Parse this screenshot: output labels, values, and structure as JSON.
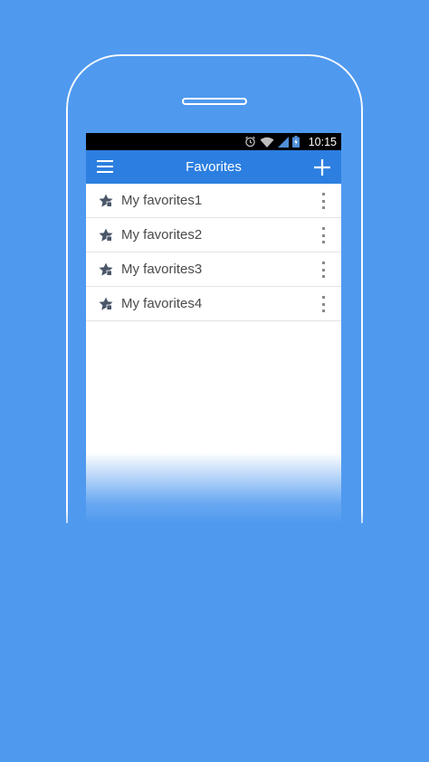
{
  "status_bar": {
    "time": "10:15",
    "icons": [
      "alarm-icon",
      "wifi-icon",
      "signal-icon",
      "battery-charging-icon"
    ]
  },
  "app_bar": {
    "title": "Favorites",
    "menu_icon": "hamburger-menu-icon",
    "add_icon": "plus-icon"
  },
  "favorites": [
    {
      "label": "My favorites1"
    },
    {
      "label": "My favorites2"
    },
    {
      "label": "My favorites3"
    },
    {
      "label": "My favorites4"
    }
  ],
  "colors": {
    "background": "#4f99ef",
    "app_bar": "#2c7fe0",
    "status_bar": "#000000",
    "list_bg": "#ffffff",
    "text": "#4a4a4a"
  }
}
